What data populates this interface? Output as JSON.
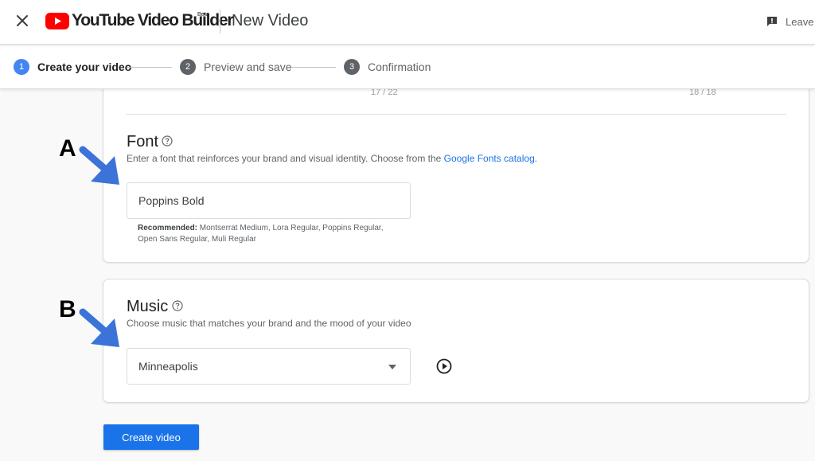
{
  "header": {
    "logo_text": "YouTube Video Builder",
    "logo_badge": "Beta",
    "title": "New Video",
    "leave_label": "Leave",
    "brand_color": "#ff0000"
  },
  "stepper": {
    "steps": [
      {
        "number": "1",
        "label": "Create your video",
        "active": true
      },
      {
        "number": "2",
        "label": "Preview and save",
        "active": false
      },
      {
        "number": "3",
        "label": "Confirmation",
        "active": false
      }
    ]
  },
  "counters": {
    "left": "17 / 22",
    "right": "18 / 18"
  },
  "font_section": {
    "title": "Font",
    "description_prefix": "Enter a font that reinforces your brand and visual identity. Choose from the ",
    "link_text": "Google Fonts catalog",
    "description_suffix": ".",
    "input_value": "Poppins Bold",
    "hint_label": "Recommended:",
    "hint_text": " Montserrat Medium, Lora Regular, Poppins Regular, Open Sans Regular, Muli Regular"
  },
  "music_section": {
    "title": "Music",
    "description": "Choose music that matches your brand and the mood of your video",
    "selected_value": "Minneapolis"
  },
  "create_button_label": "Create video",
  "callouts": {
    "a": "A",
    "b": "B",
    "arrow_color": "#3b73d8"
  },
  "icons": [
    "close-icon",
    "youtube-logo-icon",
    "feedback-icon",
    "help-icon",
    "dropdown-caret-icon",
    "play-icon",
    "callout-arrow-icon"
  ]
}
